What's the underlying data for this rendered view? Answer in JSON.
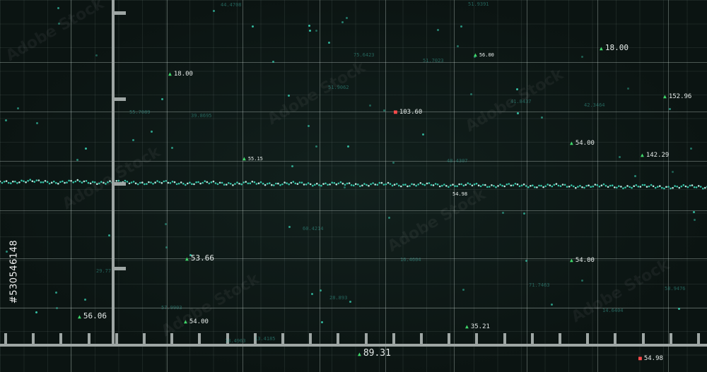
{
  "stock_id": "#530546148",
  "labels": [
    {
      "text": "18.00",
      "arrow": "up",
      "size": "normal"
    },
    {
      "text": "18.00",
      "arrow": "up",
      "size": "big"
    },
    {
      "text": "56.00",
      "arrow": "up",
      "size": "tiny"
    },
    {
      "text": "103.60",
      "arrow": "down",
      "size": "normal"
    },
    {
      "text": "152.96",
      "arrow": "up",
      "size": "normal"
    },
    {
      "text": "54.00",
      "arrow": "up",
      "size": "normal"
    },
    {
      "text": "142.29",
      "arrow": "up",
      "size": "normal"
    },
    {
      "text": "55.15",
      "arrow": "up",
      "size": "tiny"
    },
    {
      "text": "54.98",
      "arrow": "none",
      "size": "tiny"
    },
    {
      "text": "53.66",
      "arrow": "up",
      "size": "big"
    },
    {
      "text": "54.00",
      "arrow": "up",
      "size": "normal"
    },
    {
      "text": "56.06",
      "arrow": "up",
      "size": "big"
    },
    {
      "text": "54.00",
      "arrow": "up",
      "size": "normal"
    },
    {
      "text": "35.21",
      "arrow": "up",
      "size": "normal"
    },
    {
      "text": "89.31",
      "arrow": "up",
      "size": "huge"
    },
    {
      "text": "54.98",
      "arrow": "down",
      "size": "normal"
    }
  ],
  "faint_labels": [
    "44.4708",
    "51.9391",
    "75.6423",
    "51.7023",
    "51.9062",
    "39.8695",
    "55.7089",
    "16.4604",
    "41.8437",
    "42.3464",
    "28.893",
    "57.9903",
    "14.6404",
    "29.77",
    "60.4214",
    "18.4963",
    "71.7463",
    "58.9476",
    "48.4307",
    "13.4185"
  ],
  "colors": {
    "background": "#0d1614",
    "accent": "#36c4a8",
    "up": "#3fd86a",
    "down": "#ff4b4b",
    "ruler": "#9ea6a4"
  }
}
